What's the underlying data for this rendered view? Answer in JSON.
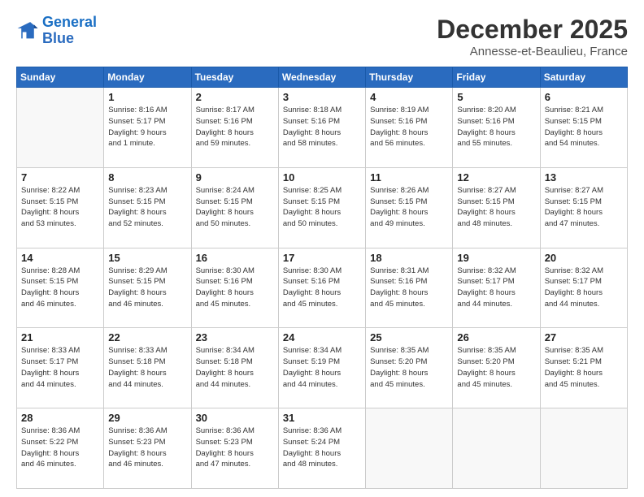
{
  "logo": {
    "line1": "General",
    "line2": "Blue"
  },
  "title": "December 2025",
  "subtitle": "Annesse-et-Beaulieu, France",
  "header_days": [
    "Sunday",
    "Monday",
    "Tuesday",
    "Wednesday",
    "Thursday",
    "Friday",
    "Saturday"
  ],
  "weeks": [
    [
      {
        "day": "",
        "info": ""
      },
      {
        "day": "1",
        "info": "Sunrise: 8:16 AM\nSunset: 5:17 PM\nDaylight: 9 hours\nand 1 minute."
      },
      {
        "day": "2",
        "info": "Sunrise: 8:17 AM\nSunset: 5:16 PM\nDaylight: 8 hours\nand 59 minutes."
      },
      {
        "day": "3",
        "info": "Sunrise: 8:18 AM\nSunset: 5:16 PM\nDaylight: 8 hours\nand 58 minutes."
      },
      {
        "day": "4",
        "info": "Sunrise: 8:19 AM\nSunset: 5:16 PM\nDaylight: 8 hours\nand 56 minutes."
      },
      {
        "day": "5",
        "info": "Sunrise: 8:20 AM\nSunset: 5:16 PM\nDaylight: 8 hours\nand 55 minutes."
      },
      {
        "day": "6",
        "info": "Sunrise: 8:21 AM\nSunset: 5:15 PM\nDaylight: 8 hours\nand 54 minutes."
      }
    ],
    [
      {
        "day": "7",
        "info": "Sunrise: 8:22 AM\nSunset: 5:15 PM\nDaylight: 8 hours\nand 53 minutes."
      },
      {
        "day": "8",
        "info": "Sunrise: 8:23 AM\nSunset: 5:15 PM\nDaylight: 8 hours\nand 52 minutes."
      },
      {
        "day": "9",
        "info": "Sunrise: 8:24 AM\nSunset: 5:15 PM\nDaylight: 8 hours\nand 50 minutes."
      },
      {
        "day": "10",
        "info": "Sunrise: 8:25 AM\nSunset: 5:15 PM\nDaylight: 8 hours\nand 50 minutes."
      },
      {
        "day": "11",
        "info": "Sunrise: 8:26 AM\nSunset: 5:15 PM\nDaylight: 8 hours\nand 49 minutes."
      },
      {
        "day": "12",
        "info": "Sunrise: 8:27 AM\nSunset: 5:15 PM\nDaylight: 8 hours\nand 48 minutes."
      },
      {
        "day": "13",
        "info": "Sunrise: 8:27 AM\nSunset: 5:15 PM\nDaylight: 8 hours\nand 47 minutes."
      }
    ],
    [
      {
        "day": "14",
        "info": "Sunrise: 8:28 AM\nSunset: 5:15 PM\nDaylight: 8 hours\nand 46 minutes."
      },
      {
        "day": "15",
        "info": "Sunrise: 8:29 AM\nSunset: 5:15 PM\nDaylight: 8 hours\nand 46 minutes."
      },
      {
        "day": "16",
        "info": "Sunrise: 8:30 AM\nSunset: 5:16 PM\nDaylight: 8 hours\nand 45 minutes."
      },
      {
        "day": "17",
        "info": "Sunrise: 8:30 AM\nSunset: 5:16 PM\nDaylight: 8 hours\nand 45 minutes."
      },
      {
        "day": "18",
        "info": "Sunrise: 8:31 AM\nSunset: 5:16 PM\nDaylight: 8 hours\nand 45 minutes."
      },
      {
        "day": "19",
        "info": "Sunrise: 8:32 AM\nSunset: 5:17 PM\nDaylight: 8 hours\nand 44 minutes."
      },
      {
        "day": "20",
        "info": "Sunrise: 8:32 AM\nSunset: 5:17 PM\nDaylight: 8 hours\nand 44 minutes."
      }
    ],
    [
      {
        "day": "21",
        "info": "Sunrise: 8:33 AM\nSunset: 5:17 PM\nDaylight: 8 hours\nand 44 minutes."
      },
      {
        "day": "22",
        "info": "Sunrise: 8:33 AM\nSunset: 5:18 PM\nDaylight: 8 hours\nand 44 minutes."
      },
      {
        "day": "23",
        "info": "Sunrise: 8:34 AM\nSunset: 5:18 PM\nDaylight: 8 hours\nand 44 minutes."
      },
      {
        "day": "24",
        "info": "Sunrise: 8:34 AM\nSunset: 5:19 PM\nDaylight: 8 hours\nand 44 minutes."
      },
      {
        "day": "25",
        "info": "Sunrise: 8:35 AM\nSunset: 5:20 PM\nDaylight: 8 hours\nand 45 minutes."
      },
      {
        "day": "26",
        "info": "Sunrise: 8:35 AM\nSunset: 5:20 PM\nDaylight: 8 hours\nand 45 minutes."
      },
      {
        "day": "27",
        "info": "Sunrise: 8:35 AM\nSunset: 5:21 PM\nDaylight: 8 hours\nand 45 minutes."
      }
    ],
    [
      {
        "day": "28",
        "info": "Sunrise: 8:36 AM\nSunset: 5:22 PM\nDaylight: 8 hours\nand 46 minutes."
      },
      {
        "day": "29",
        "info": "Sunrise: 8:36 AM\nSunset: 5:23 PM\nDaylight: 8 hours\nand 46 minutes."
      },
      {
        "day": "30",
        "info": "Sunrise: 8:36 AM\nSunset: 5:23 PM\nDaylight: 8 hours\nand 47 minutes."
      },
      {
        "day": "31",
        "info": "Sunrise: 8:36 AM\nSunset: 5:24 PM\nDaylight: 8 hours\nand 48 minutes."
      },
      {
        "day": "",
        "info": ""
      },
      {
        "day": "",
        "info": ""
      },
      {
        "day": "",
        "info": ""
      }
    ]
  ]
}
